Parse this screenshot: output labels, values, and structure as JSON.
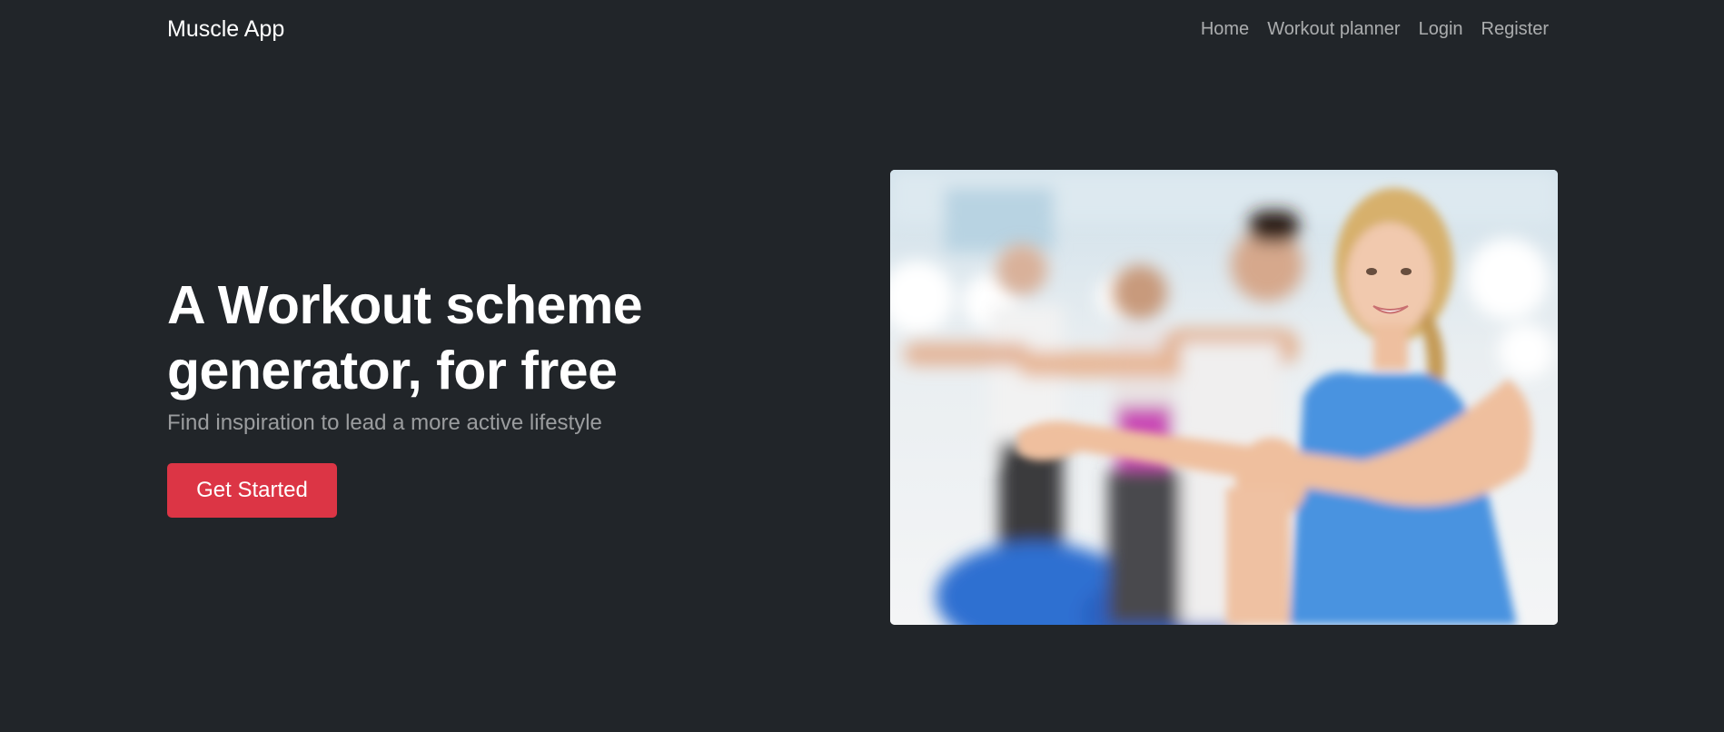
{
  "navbar": {
    "brand": "Muscle App",
    "links": [
      {
        "label": "Home"
      },
      {
        "label": "Workout planner"
      },
      {
        "label": "Login"
      },
      {
        "label": "Register"
      }
    ]
  },
  "hero": {
    "title_line1": "A Workout scheme",
    "title_line2": "generator, for free",
    "subtitle": "Find inspiration to lead a more active lifestyle",
    "cta_label": "Get Started"
  },
  "colors": {
    "background": "#212529",
    "accent": "#dc3545",
    "nav_text": "#9ea0a3"
  }
}
